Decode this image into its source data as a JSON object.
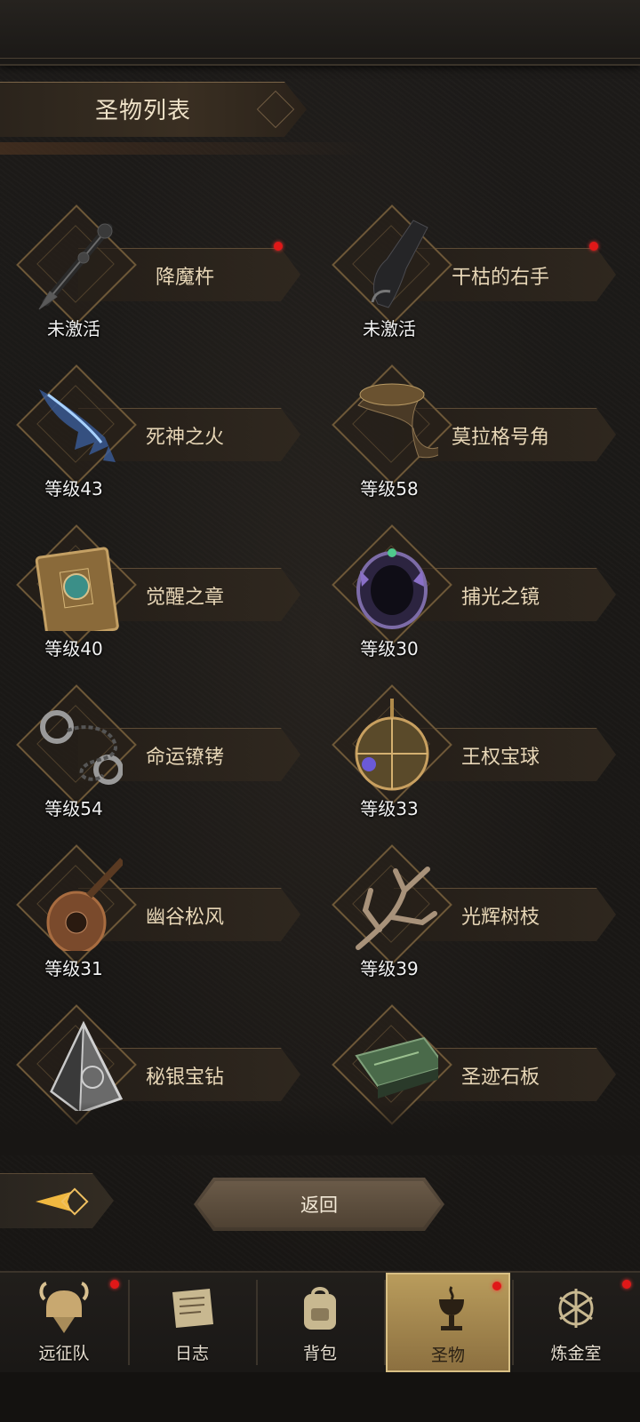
{
  "header": {
    "title": "圣物列表"
  },
  "relics": [
    {
      "name": "降魔杵",
      "status": "未激活",
      "has_alert": true,
      "icon": "vajra-icon"
    },
    {
      "name": "干枯的右手",
      "status": "未激活",
      "has_alert": true,
      "icon": "withered-hand-icon"
    },
    {
      "name": "死神之火",
      "status": "等级43",
      "has_alert": false,
      "icon": "spectral-claw-icon"
    },
    {
      "name": "莫拉格号角",
      "status": "等级58",
      "has_alert": false,
      "icon": "horn-icon"
    },
    {
      "name": "觉醒之章",
      "status": "等级40",
      "has_alert": false,
      "icon": "tome-icon"
    },
    {
      "name": "捕光之镜",
      "status": "等级30",
      "has_alert": false,
      "icon": "crystal-mirror-icon"
    },
    {
      "name": "命运镣铐",
      "status": "等级54",
      "has_alert": false,
      "icon": "shackles-icon"
    },
    {
      "name": "王权宝球",
      "status": "等级33",
      "has_alert": false,
      "icon": "orb-icon"
    },
    {
      "name": "幽谷松风",
      "status": "等级31",
      "has_alert": false,
      "icon": "lute-icon"
    },
    {
      "name": "光辉树枝",
      "status": "等级39",
      "has_alert": false,
      "icon": "branch-icon"
    },
    {
      "name": "秘银宝钻",
      "status": "",
      "has_alert": false,
      "icon": "pyramid-gem-icon"
    },
    {
      "name": "圣迹石板",
      "status": "",
      "has_alert": false,
      "icon": "stone-tablet-icon"
    }
  ],
  "actions": {
    "back_label": "返回"
  },
  "nav": [
    {
      "label": "远征队",
      "icon": "viking-helmet-icon",
      "has_alert": true,
      "active": false
    },
    {
      "label": "日志",
      "icon": "scroll-icon",
      "has_alert": false,
      "active": false
    },
    {
      "label": "背包",
      "icon": "backpack-icon",
      "has_alert": false,
      "active": false
    },
    {
      "label": "圣物",
      "icon": "chalice-icon",
      "has_alert": true,
      "active": true
    },
    {
      "label": "炼金室",
      "icon": "alchemy-icon",
      "has_alert": true,
      "active": false
    }
  ],
  "colors": {
    "accent": "#c9a862",
    "alert": "#e01818",
    "text": "#e7d6b6"
  }
}
